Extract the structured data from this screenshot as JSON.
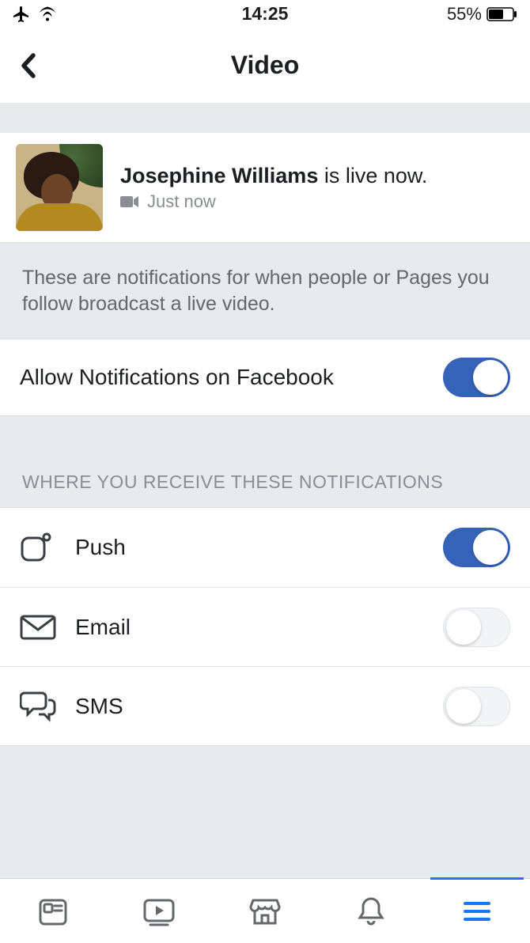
{
  "status": {
    "time": "14:25",
    "battery_text": "55%"
  },
  "header": {
    "title": "Video"
  },
  "live": {
    "name": "Josephine Williams",
    "suffix": " is live now.",
    "subtext": "Just now"
  },
  "description": "These are notifications for when people or Pages you follow broadcast a live video.",
  "allow": {
    "label": "Allow Notifications on Facebook",
    "on": true
  },
  "section_header": "WHERE YOU RECEIVE THESE NOTIFICATIONS",
  "channels": {
    "push": {
      "label": "Push",
      "on": true
    },
    "email": {
      "label": "Email",
      "on": false
    },
    "sms": {
      "label": "SMS",
      "on": false
    }
  }
}
